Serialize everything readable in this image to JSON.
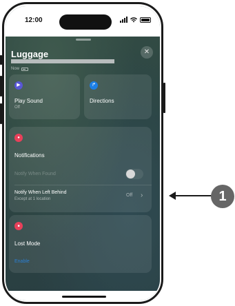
{
  "status_bar": {
    "time": "12:00"
  },
  "sheet": {
    "title": "Luggage",
    "subtitle": "Now",
    "close_glyph": "✕"
  },
  "actions": {
    "play_sound": {
      "label": "Play Sound",
      "sub": "Off",
      "icon": "play-icon",
      "icon_glyph": "▶",
      "color": "#5856d6"
    },
    "directions": {
      "label": "Directions",
      "icon": "directions-arrow-icon",
      "icon_glyph": "↱",
      "color": "#1c7fe6"
    }
  },
  "notifications": {
    "title": "Notifications",
    "icon": "bell-icon",
    "icon_glyph": "●",
    "color": "#e8405a",
    "notify_when_found": {
      "label": "Notify When Found",
      "enabled": false
    },
    "notify_left_behind": {
      "label": "Notify When Left Behind",
      "sub": "Except at 1 location",
      "value": "Off",
      "chevron": "›"
    }
  },
  "lost_mode": {
    "title": "Lost Mode",
    "icon": "lock-icon",
    "icon_glyph": "■",
    "color": "#e8405a",
    "action": "Enable"
  },
  "callout": {
    "number": "1"
  }
}
